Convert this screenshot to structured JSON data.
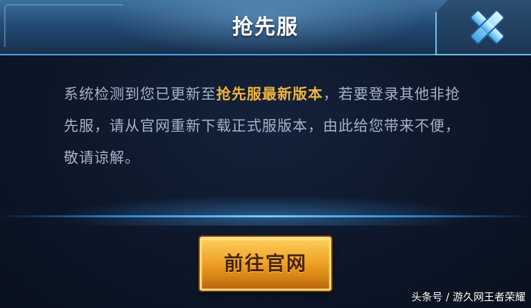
{
  "dialog": {
    "title": "抢先服",
    "message": {
      "part1": "系统检测到您已更新至",
      "highlight": "抢先服最新版本",
      "part2": "，若要登录其他非抢先服，请从官网重新下载正式服版本，由此给您带来不便，敬请谅解。"
    },
    "primary_button_label": "前往官网",
    "close_icon": "close-x-icon"
  },
  "watermark": "头条号 / 游久网王者荣耀",
  "colors": {
    "highlight": "#f0b43e",
    "body_text": "#a9b2c6",
    "accent_blue": "#4fa7e0",
    "button_gold": "#f0a52a"
  }
}
